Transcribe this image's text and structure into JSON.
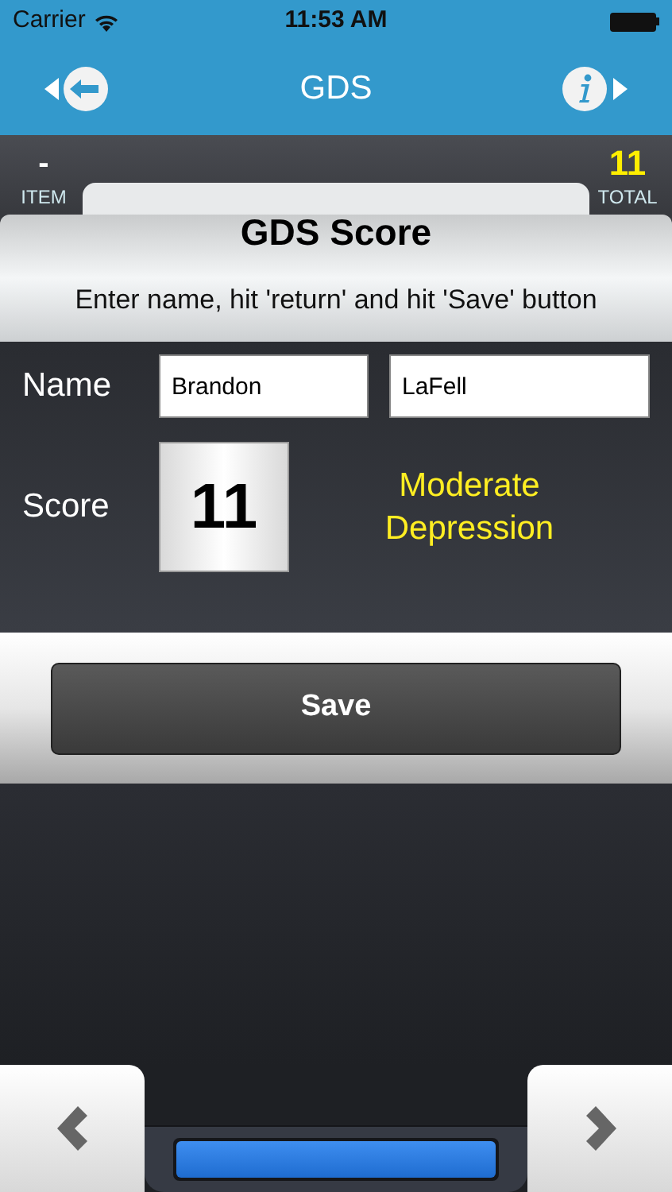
{
  "status_bar": {
    "carrier": "Carrier",
    "time": "11:53 AM"
  },
  "nav": {
    "title": "GDS"
  },
  "header": {
    "item_value": "-",
    "item_label": "ITEM",
    "total_value": "11",
    "total_label": "TOTAL",
    "title": "GDS Score",
    "instruction": "Enter name, hit 'return' and hit 'Save' button"
  },
  "form": {
    "name_label": "Name",
    "first_name": "Brandon",
    "last_name": "LaFell",
    "score_label": "Score",
    "score": "11",
    "result": "Moderate Depression"
  },
  "save_button": "Save",
  "progress": {
    "level": 1
  }
}
